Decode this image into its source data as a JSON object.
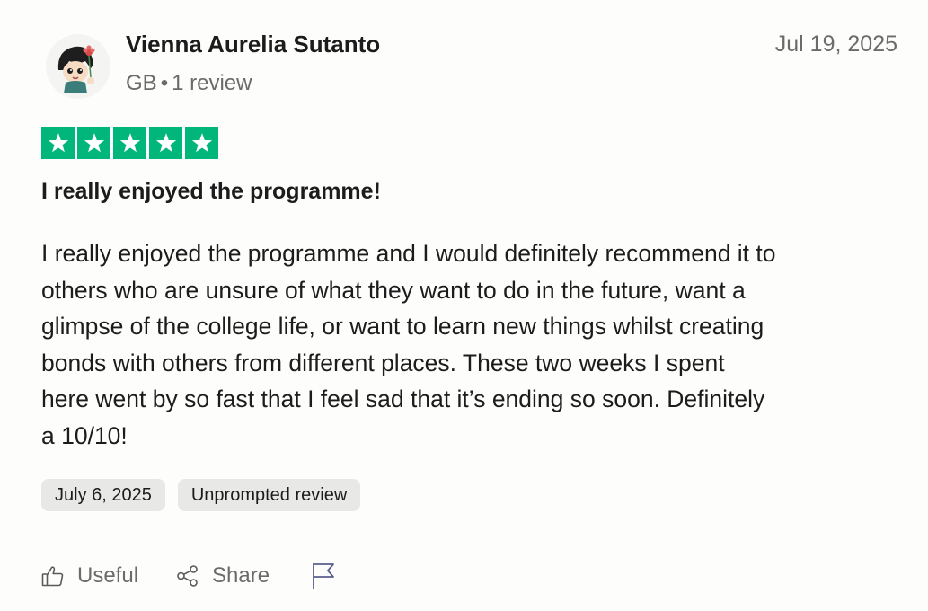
{
  "reviewer": {
    "name": "Vienna Aurelia Sutanto",
    "country": "GB",
    "separator": "•",
    "review_count": "1 review"
  },
  "review": {
    "posted_date": "Jul 19, 2025",
    "rating": 5,
    "rating_max": 5,
    "title": "I really enjoyed the programme!",
    "body_lines": [
      "I really enjoyed the programme and I would definitely recommend it to",
      "others who are unsure of what they want to do in the future, want a",
      "glimpse of the college life, or want to learn new things whilst creating",
      "bonds with others from different places. These two weeks I spent",
      "here went by so fast that I feel sad that it’s ending so soon. Definitely",
      "a 10/10!"
    ],
    "tags": [
      "July 6, 2025",
      "Unprompted review"
    ]
  },
  "actions": {
    "useful_label": "Useful",
    "share_label": "Share"
  },
  "icons": {
    "useful": "thumbs-up-icon",
    "share": "share-icon",
    "report": "flag-icon",
    "star": "star-icon"
  },
  "colors": {
    "star_green": "#00b67a",
    "text_primary": "#1c1c1c",
    "text_muted": "#6b6b6b",
    "tag_bg": "#e8e8e6",
    "flag_color": "#5b5f8f"
  }
}
